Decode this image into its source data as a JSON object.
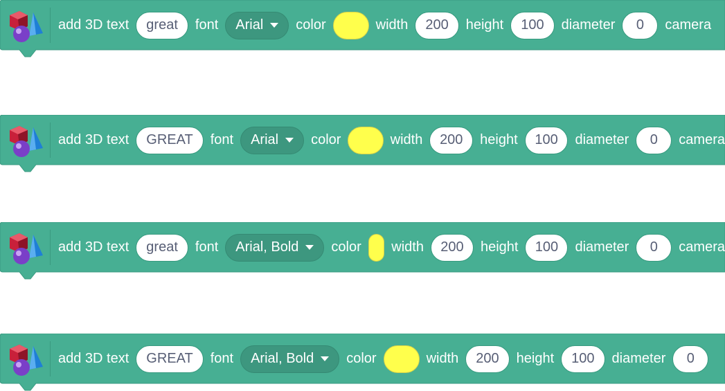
{
  "colors": {
    "block": "#47af93",
    "swatch": "#ffff4c"
  },
  "blocks": [
    {
      "add_label": "add 3D text",
      "text": "great",
      "font_label": "font",
      "font": "Arial",
      "color_label": "color",
      "width_label": "width",
      "width": "200",
      "height_label": "height",
      "height": "100",
      "diameter_label": "diameter",
      "diameter": "0",
      "tail_label": "camera"
    },
    {
      "add_label": "add 3D text",
      "text": "GREAT",
      "font_label": "font",
      "font": "Arial",
      "color_label": "color",
      "width_label": "width",
      "width": "200",
      "height_label": "height",
      "height": "100",
      "diameter_label": "diameter",
      "diameter": "0",
      "tail_label": "camera"
    },
    {
      "add_label": "add 3D text",
      "text": "great",
      "font_label": "font",
      "font": "Arial, Bold",
      "color_label": "color",
      "width_label": "width",
      "width": "200",
      "height_label": "height",
      "height": "100",
      "diameter_label": "diameter",
      "diameter": "0",
      "tail_label": "camera"
    },
    {
      "add_label": "add 3D text",
      "text": "GREAT",
      "font_label": "font",
      "font": "Arial, Bold",
      "color_label": "color",
      "width_label": "width",
      "width": "200",
      "height_label": "height",
      "height": "100",
      "diameter_label": "diameter",
      "diameter": "0",
      "tail_label": ""
    }
  ],
  "icons": {
    "block_icon": "3d-shapes-icon",
    "dropdown_caret": "caret-down-icon"
  }
}
